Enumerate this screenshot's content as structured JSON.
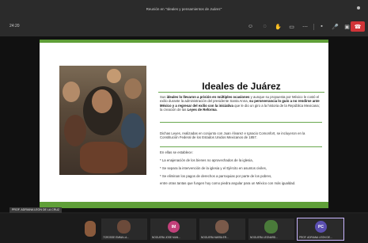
{
  "window": {
    "title": "Reunión en \"Ideales y pensamientos de Juárez\""
  },
  "toolbar": {
    "timer": "24:20",
    "icons": [
      "participants-icon",
      "chat-icon",
      "reactions-icon",
      "view-icon",
      "more-icon",
      "camera-icon",
      "mic-icon",
      "share-icon",
      "leave-icon"
    ]
  },
  "slide": {
    "title": "Ideales de Juárez",
    "p1_start": "Sus ",
    "p1_bold1": "ideales lo llevaron a prisión en múltiples ocasiones",
    "p1_mid": " y aunque su propuesta por México le costó el exilio durante la administración del presidente Santa Anna, ",
    "p1_bold2": "su perseverancia lo guío a no rendirse ante México y a regresar del exilio con la iniciativa",
    "p1_end": " que le dio un giro a la historia de la República Mexicana; la creación de las ",
    "p1_bold3": "Leyes de Reforma",
    "p1_tail": ".",
    "p2": "Dichas Leyes, realizadas en conjunto con Juan Álvarez e Ignacio Comonfort, se incluyeron en la Constitución Federal de los Estados Unidos Mexicanos de 1857.",
    "intro": "En ellas se establece:",
    "bullets": [
      "* La enajenación de los bienes no aprovechados de la iglesia,",
      "* Se separa la intervención de la iglesia y el Ejército en asuntos civiles,",
      "* Se eliminan los pagos de derechos a parroquias por parte de los pobres,"
    ],
    "closing": "entre otras tantas que fungen hoy como piedra angular para un México con más igualdad."
  },
  "presenter_label": "PROF. ADRIANA LEON DE LA CRUZ",
  "participants": [
    {
      "name": "7CROSSE EMMA LA...",
      "initials": "",
      "color": "#6b4a3a"
    },
    {
      "name": "NOGUERA JOSE MAN...",
      "initials": "IM",
      "color": "#c2407a"
    },
    {
      "name": "NOGUERA MARÍA ER...",
      "initials": "",
      "color": "#7a5a4a"
    },
    {
      "name": "NOGUERA LEONARD...",
      "initials": "",
      "color": "#4a7a3a"
    },
    {
      "name": "PROF. ADRIANA LEON DE...",
      "initials": "PC",
      "color": "#5b4fb0"
    },
    {
      "name": "",
      "initials": "",
      "color": "#8a5a3c"
    }
  ]
}
